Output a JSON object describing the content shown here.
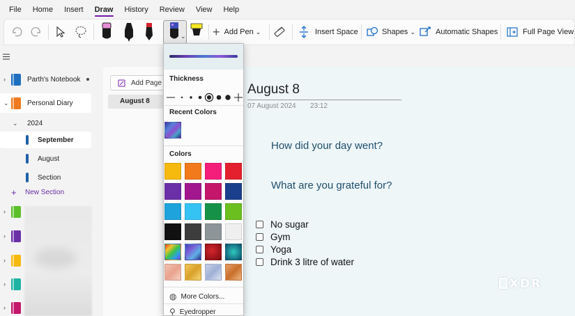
{
  "menu": [
    "File",
    "Home",
    "Insert",
    "Draw",
    "History",
    "Review",
    "View",
    "Help"
  ],
  "active_menu": "Draw",
  "ribbon": {
    "add_pen": "Add Pen",
    "insert_space": "Insert Space",
    "shapes": "Shapes",
    "automatic_shapes": "Automatic Shapes",
    "full_page_view": "Full Page View"
  },
  "notebooks": {
    "parths_notebook": "Parth's Notebook",
    "personal_diary": "Personal Diary",
    "group_2024": "2024",
    "sections": [
      "September",
      "August",
      "Section"
    ],
    "new_section": "New Section"
  },
  "pages": {
    "add_page": "Add Page",
    "items": [
      "August 8"
    ]
  },
  "page": {
    "title": "August 8",
    "date": "07 August 2024",
    "time": "23:12",
    "prompts": [
      "How did your day went?",
      "What are you grateful for?"
    ],
    "todos": [
      "No sugar",
      "Gym",
      "Yoga",
      "Drink 3 litre of water"
    ]
  },
  "pen_menu": {
    "thickness": "Thickness",
    "recent_colors": "Recent Colors",
    "colors": "Colors",
    "more_colors": "More Colors...",
    "eyedropper": "Eyedropper",
    "palette": [
      [
        "#f6b90d",
        "#f27a1a",
        "#f51e7a",
        "#e4202e"
      ],
      [
        "#6b2fa8",
        "#a3178e",
        "#c4176b",
        "#1a3f8c"
      ],
      [
        "#1ea3dc",
        "#35c3f3",
        "#159247",
        "#6bbf1f"
      ],
      [
        "#111111",
        "#3d3d3d",
        "#8d9599",
        "#efefef"
      ]
    ]
  },
  "watermark": "XDR",
  "colors": {
    "accent": "#7719aa",
    "canvas_bg": "#eef6f8",
    "prompt_text": "#1f4e6b"
  }
}
